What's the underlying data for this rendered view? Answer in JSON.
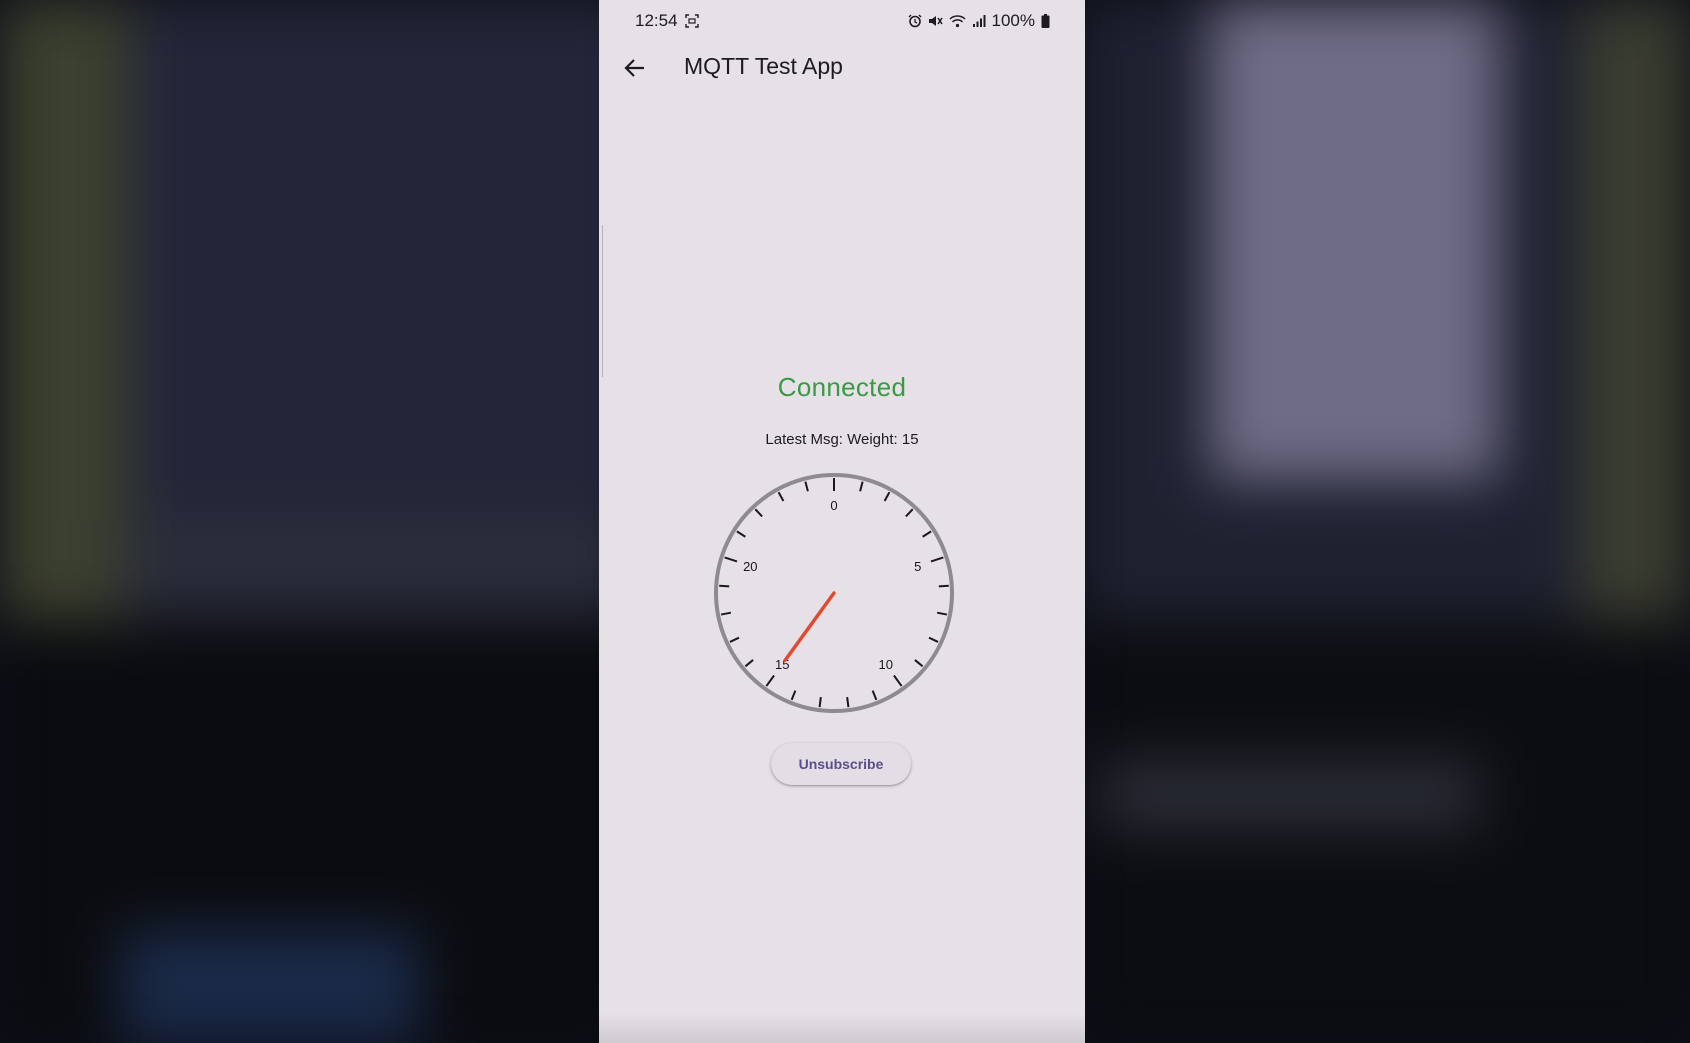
{
  "status_bar": {
    "time": "12:54",
    "battery": "100%",
    "icons": [
      "screenshot-icon",
      "alarm-icon",
      "mute-icon",
      "wifi-icon",
      "signal-icon",
      "battery-icon"
    ]
  },
  "app_bar": {
    "back_icon": "arrow-back-icon",
    "title": "MQTT Test App"
  },
  "connection": {
    "status": "Connected",
    "status_color": "#3a9a44"
  },
  "latest_message": "Latest Msg: Weight: 15",
  "gauge": {
    "min": 0,
    "max": 25,
    "value": 15,
    "major_labels": [
      "0",
      "5",
      "10",
      "15",
      "20"
    ],
    "tick_count": 25,
    "needle_color": "#e3492e",
    "rim_color": "#8e8b90"
  },
  "buttons": {
    "unsubscribe_label": "Unsubscribe"
  }
}
